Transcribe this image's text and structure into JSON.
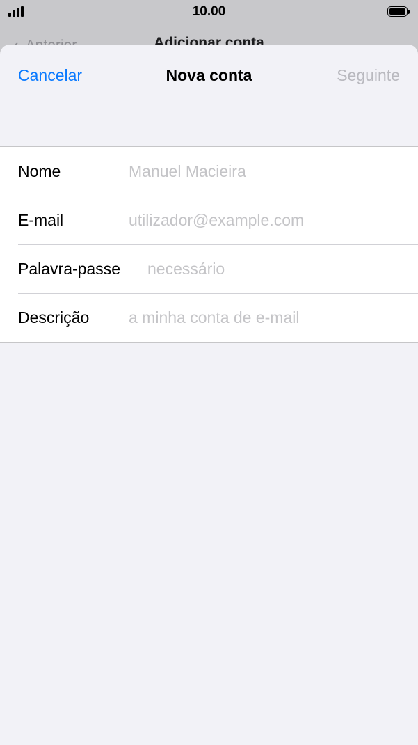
{
  "status_bar": {
    "time": "10.00"
  },
  "underlying_nav": {
    "back_label": "Anterior",
    "title": "Adicionar conta"
  },
  "sheet": {
    "nav": {
      "cancel_label": "Cancelar",
      "title": "Nova conta",
      "next_label": "Seguinte"
    },
    "fields": [
      {
        "label": "Nome",
        "value": "",
        "placeholder": "Manuel Macieira"
      },
      {
        "label": "E-mail",
        "value": "",
        "placeholder": "utilizador@example.com"
      },
      {
        "label": "Palavra-passe",
        "value": "",
        "placeholder": "necessário"
      },
      {
        "label": "Descrição",
        "value": "",
        "placeholder": "a minha conta de e-mail"
      }
    ]
  },
  "colors": {
    "accent": "#0a7aff",
    "disabled": "#b9b9bf",
    "placeholder": "#c4c4c7",
    "grouped_background": "#f2f2f7"
  },
  "icons": [
    "cellular-signal-icon",
    "battery-icon",
    "chevron-left-icon"
  ]
}
